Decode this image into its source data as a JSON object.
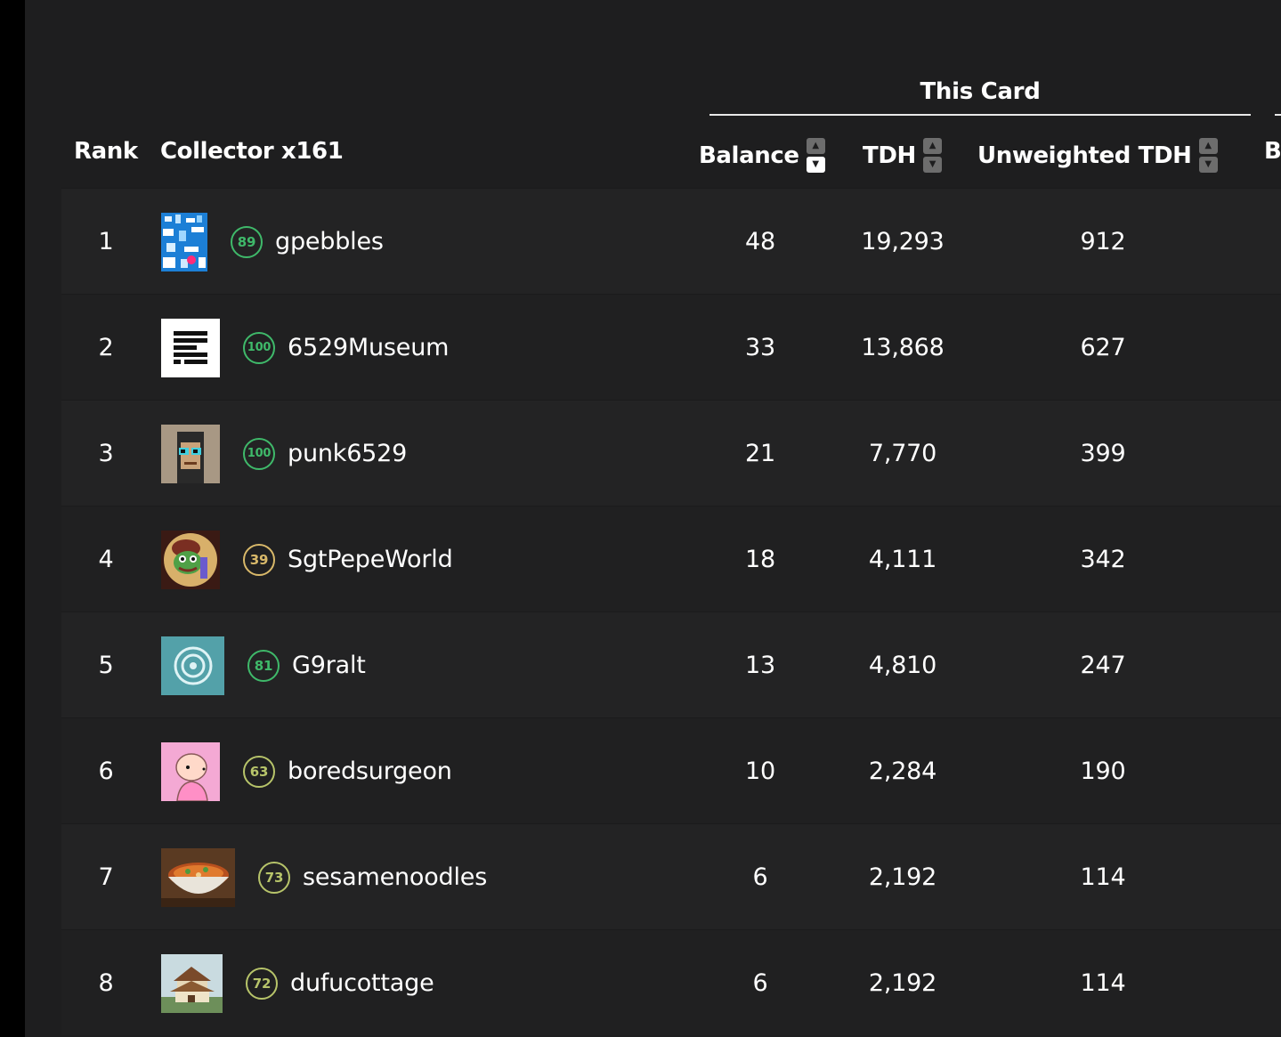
{
  "table": {
    "group_title": "This Card",
    "headers": {
      "rank": "Rank",
      "collector": "Collector x161",
      "balance": "Balance",
      "tdh": "TDH",
      "unweighted_tdh": "Unweighted TDH",
      "next": "B"
    },
    "rows": [
      {
        "rank": "1",
        "level": "89",
        "name": "gpebbles",
        "balance": "48",
        "tdh": "19,293",
        "unweighted_tdh": "912",
        "level_color": "#3fb96a"
      },
      {
        "rank": "2",
        "level": "100",
        "name": "6529Museum",
        "balance": "33",
        "tdh": "13,868",
        "unweighted_tdh": "627",
        "level_color": "#3fb96a"
      },
      {
        "rank": "3",
        "level": "100",
        "name": "punk6529",
        "balance": "21",
        "tdh": "7,770",
        "unweighted_tdh": "399",
        "level_color": "#3fb96a"
      },
      {
        "rank": "4",
        "level": "39",
        "name": "SgtPepeWorld",
        "balance": "18",
        "tdh": "4,111",
        "unweighted_tdh": "342",
        "level_color": "#d9b96a"
      },
      {
        "rank": "5",
        "level": "81",
        "name": "G9ralt",
        "balance": "13",
        "tdh": "4,810",
        "unweighted_tdh": "247",
        "level_color": "#3fb96a"
      },
      {
        "rank": "6",
        "level": "63",
        "name": "boredsurgeon",
        "balance": "10",
        "tdh": "2,284",
        "unweighted_tdh": "190",
        "level_color": "#b7c46a"
      },
      {
        "rank": "7",
        "level": "73",
        "name": "sesamenoodles",
        "balance": "6",
        "tdh": "2,192",
        "unweighted_tdh": "114",
        "level_color": "#b7c46a"
      },
      {
        "rank": "8",
        "level": "72",
        "name": "dufucottage",
        "balance": "6",
        "tdh": "2,192",
        "unweighted_tdh": "114",
        "level_color": "#b7c46a"
      }
    ]
  }
}
